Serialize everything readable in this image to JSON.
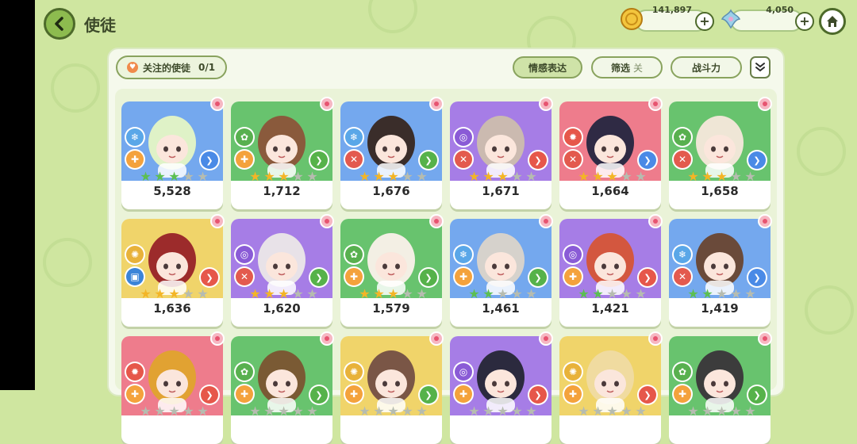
{
  "header": {
    "title": "使徒"
  },
  "currency": {
    "gold": {
      "value": "141,897",
      "icon": "gold-coin-icon"
    },
    "crystal": {
      "value": "4,050",
      "icon": "crystal-icon"
    }
  },
  "toolbar": {
    "follow_label": "关注的使徒",
    "follow_count": "0/1",
    "emotion_label": "情感表达",
    "filter_label": "筛选",
    "filter_state": "关",
    "sort_label": "战斗力"
  },
  "colors": {
    "blue": "#74a8ee",
    "green": "#68c36e",
    "red": "#ee7c8c",
    "purple": "#a67de6",
    "yellow": "#f0d46a"
  },
  "cards": [
    {
      "cp": "5,528",
      "bg": "blue",
      "stars": 3,
      "star_color": "green",
      "el": "ice",
      "role": "heal",
      "hair": "#dff2c7",
      "dir": "blue"
    },
    {
      "cp": "1,712",
      "bg": "green",
      "stars": 3,
      "star_color": "gold",
      "el": "nature",
      "role": "heal",
      "hair": "#8a5a3c",
      "dir": "green"
    },
    {
      "cp": "1,676",
      "bg": "blue",
      "stars": 3,
      "star_color": "gold",
      "el": "ice",
      "role": "attack",
      "hair": "#3a2d2a",
      "dir": "green"
    },
    {
      "cp": "1,671",
      "bg": "purple",
      "stars": 3,
      "star_color": "gold",
      "el": "arcane",
      "role": "attack",
      "hair": "#cbbab0",
      "dir": "red"
    },
    {
      "cp": "1,664",
      "bg": "red",
      "stars": 3,
      "star_color": "gold",
      "el": "fire",
      "role": "attack",
      "hair": "#2f2a44",
      "dir": "blue"
    },
    {
      "cp": "1,658",
      "bg": "green",
      "stars": 3,
      "star_color": "gold",
      "el": "nature",
      "role": "attack",
      "hair": "#efe6d6",
      "dir": "blue"
    },
    {
      "cp": "1,636",
      "bg": "yellow",
      "stars": 3,
      "star_color": "gold",
      "el": "light",
      "role": "defense",
      "hair": "#9c2b2b",
      "dir": "red"
    },
    {
      "cp": "1,620",
      "bg": "purple",
      "stars": 3,
      "star_color": "gold",
      "el": "arcane",
      "role": "attack",
      "hair": "#e8e2e8",
      "dir": "green"
    },
    {
      "cp": "1,579",
      "bg": "green",
      "stars": 3,
      "star_color": "gold",
      "el": "nature",
      "role": "heal",
      "hair": "#f3efe4",
      "dir": "green"
    },
    {
      "cp": "1,461",
      "bg": "blue",
      "stars": 2,
      "star_color": "green",
      "el": "ice",
      "role": "heal",
      "hair": "#d6d2cc",
      "dir": "green"
    },
    {
      "cp": "1,421",
      "bg": "purple",
      "stars": 2,
      "star_color": "green",
      "el": "arcane",
      "role": "heal",
      "hair": "#d3573f",
      "dir": "red"
    },
    {
      "cp": "1,419",
      "bg": "blue",
      "stars": 2,
      "star_color": "green",
      "el": "ice",
      "role": "attack",
      "hair": "#6a4a3a",
      "dir": "blue"
    },
    {
      "cp": "",
      "bg": "red",
      "stars": 0,
      "star_color": "gold",
      "el": "fire",
      "role": "heal",
      "hair": "#e1a232",
      "dir": "red"
    },
    {
      "cp": "",
      "bg": "green",
      "stars": 0,
      "star_color": "gold",
      "el": "nature",
      "role": "heal",
      "hair": "#7a5a34",
      "dir": "green"
    },
    {
      "cp": "",
      "bg": "yellow",
      "stars": 0,
      "star_color": "gold",
      "el": "light",
      "role": "heal",
      "hair": "#7a5646",
      "dir": "green"
    },
    {
      "cp": "",
      "bg": "purple",
      "stars": 0,
      "star_color": "gold",
      "el": "arcane",
      "role": "heal",
      "hair": "#2b2a3e",
      "dir": "red"
    },
    {
      "cp": "",
      "bg": "yellow",
      "stars": 0,
      "star_color": "gold",
      "el": "light",
      "role": "heal",
      "hair": "#f0dba0",
      "dir": "red"
    },
    {
      "cp": "",
      "bg": "green",
      "stars": 0,
      "star_color": "gold",
      "el": "nature",
      "role": "heal",
      "hair": "#3c3c3c",
      "dir": "green"
    }
  ]
}
